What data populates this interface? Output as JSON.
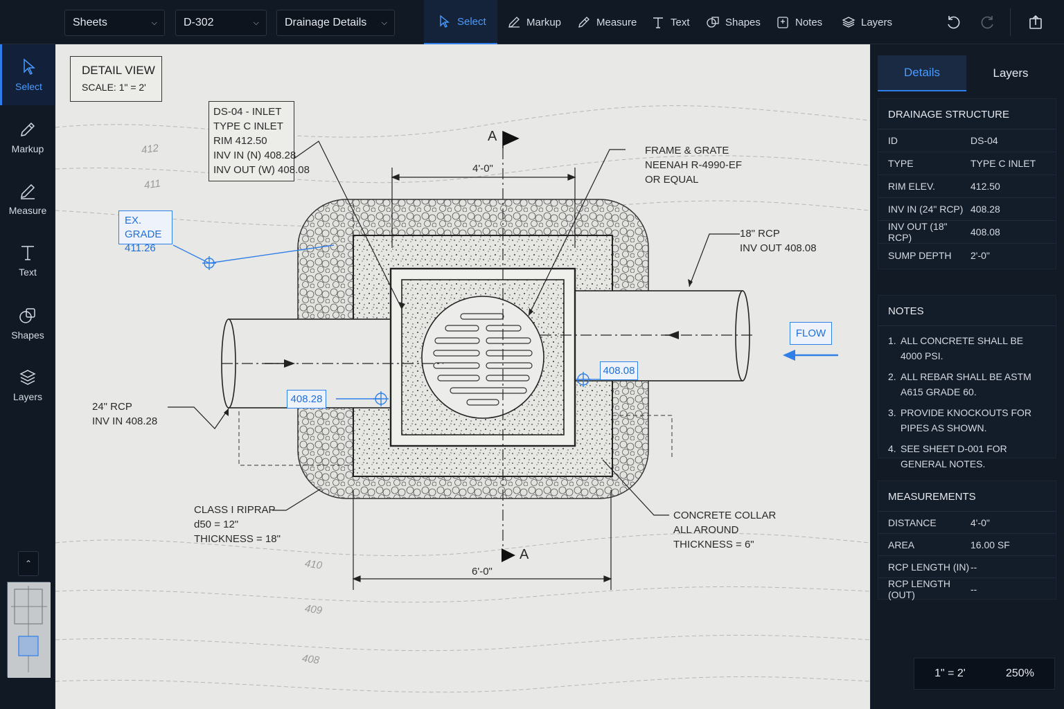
{
  "topbar": {
    "sheets_select": "Sheets",
    "sheet_number_select": "D-302",
    "view_select": "Drainage Details",
    "tools": [
      {
        "label": "Select",
        "icon": "cursor-icon"
      },
      {
        "label": "Markup",
        "icon": "pen-icon"
      },
      {
        "label": "Measure",
        "icon": "ruler-pen-icon"
      },
      {
        "label": "Text",
        "icon": "text-icon"
      },
      {
        "label": "Shapes",
        "icon": "shapes-icon"
      },
      {
        "label": "Notes",
        "icon": "note-icon"
      },
      {
        "label": "Layers",
        "icon": "layers-icon"
      }
    ],
    "active_tool": "Select"
  },
  "rail": {
    "tools": [
      {
        "label": "Select"
      },
      {
        "label": "Markup"
      },
      {
        "label": "Measure"
      },
      {
        "label": "Text"
      },
      {
        "label": "Shapes"
      },
      {
        "label": "Layers"
      }
    ]
  },
  "drawing": {
    "title_line1": "DETAIL VIEW",
    "title_line2": "SCALE: 1\" = 2'",
    "inlet_callout": [
      "DS-04 - INLET",
      "TYPE C INLET",
      "RIM 412.50",
      "INV IN (N) 408.28",
      "INV OUT (W) 408.08"
    ],
    "frame_callout": [
      "FRAME & GRATE",
      "NEENAH R-4990-EF",
      "OR EQUAL"
    ],
    "outlet_callout": [
      "18\" RCP",
      "INV OUT 408.08"
    ],
    "inlet_pipe_callout": [
      "24\" RCP",
      "INV IN 408.28"
    ],
    "riprap_callout": [
      "CLASS I RIPRAP",
      "d50 = 12\"",
      "THICKNESS = 18\""
    ],
    "collar_callout": [
      "CONCRETE COLLAR",
      "ALL AROUND",
      "THICKNESS = 6\""
    ],
    "ex_grade_line1": "EX. GRADE",
    "ex_grade_line2": "411.26",
    "inv_in_marker": "408.28",
    "inv_out_marker": "408.08",
    "flow_label": "FLOW",
    "dim_top": "4'-0\"",
    "dim_bottom": "6'-0\"",
    "section_mark": "A",
    "contours": [
      "412",
      "411",
      "410",
      "409",
      "408"
    ]
  },
  "panel": {
    "tab_details": "Details",
    "tab_layers": "Layers",
    "structure_title": "DRAINAGE STRUCTURE",
    "structure_rows": [
      {
        "k": "ID",
        "v": "DS-04"
      },
      {
        "k": "TYPE",
        "v": "TYPE C INLET"
      },
      {
        "k": "RIM ELEV.",
        "v": "412.50"
      },
      {
        "k": "INV IN (24\" RCP)",
        "v": "408.28"
      },
      {
        "k": "INV OUT (18\" RCP)",
        "v": "408.08"
      },
      {
        "k": "SUMP DEPTH",
        "v": "2'-0\""
      }
    ],
    "notes_title": "NOTES",
    "notes": [
      {
        "n": "1.",
        "t": "ALL CONCRETE SHALL BE 4000 PSI."
      },
      {
        "n": "2.",
        "t": "ALL REBAR SHALL BE ASTM A615 GRADE 60."
      },
      {
        "n": "3.",
        "t": "PROVIDE KNOCKOUTS FOR PIPES AS SHOWN."
      },
      {
        "n": "4.",
        "t": "SEE SHEET D-001 FOR GENERAL NOTES."
      }
    ],
    "measure_title": "MEASUREMENTS",
    "measure_rows": [
      {
        "k": "DISTANCE",
        "v": "4'-0\""
      },
      {
        "k": "AREA",
        "v": "16.00 SF"
      },
      {
        "k": "RCP LENGTH (IN)",
        "v": "--"
      },
      {
        "k": "RCP LENGTH (OUT)",
        "v": "--"
      }
    ],
    "scale": "1\" = 2'",
    "zoom": "250%"
  },
  "colors": {
    "accent": "#2f7fe8",
    "bg": "#0e1520",
    "paper": "#e8e8e6"
  }
}
